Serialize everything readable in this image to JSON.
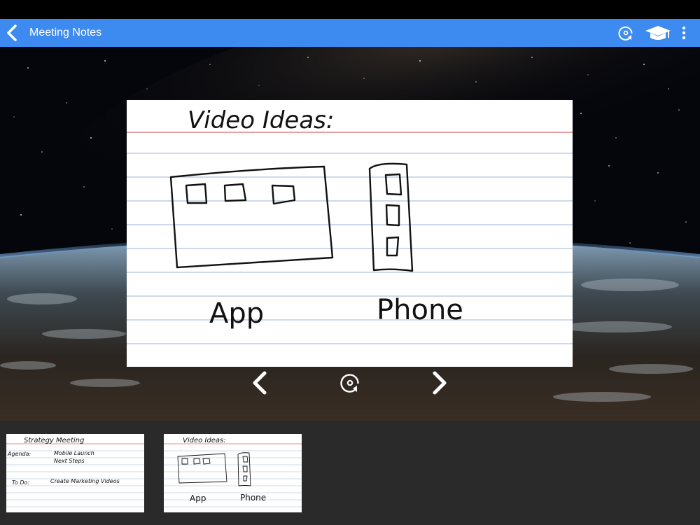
{
  "toolbar": {
    "title": "Meeting Notes",
    "back_icon": "chevron-left-icon",
    "flip_icon": "flip-card-icon",
    "study_icon": "graduation-cap-icon",
    "more_icon": "vertical-dots-icon",
    "color": "#3d8af0"
  },
  "current_card": {
    "heading": "Video Ideas:",
    "label_left": "App",
    "label_right": "Phone"
  },
  "controls": {
    "prev_icon": "chevron-left-icon",
    "flip_icon": "flip-card-icon",
    "next_icon": "chevron-right-icon"
  },
  "thumbnails": [
    {
      "title": "Strategy Meeting",
      "agenda_label": "Agenda:",
      "agenda_items": [
        "Mobile Launch",
        "Next Steps"
      ],
      "todo_label": "To Do:",
      "todo_item": "Create Marketing Videos"
    },
    {
      "title": "Video Ideas:",
      "label_left": "App",
      "label_right": "Phone"
    }
  ]
}
